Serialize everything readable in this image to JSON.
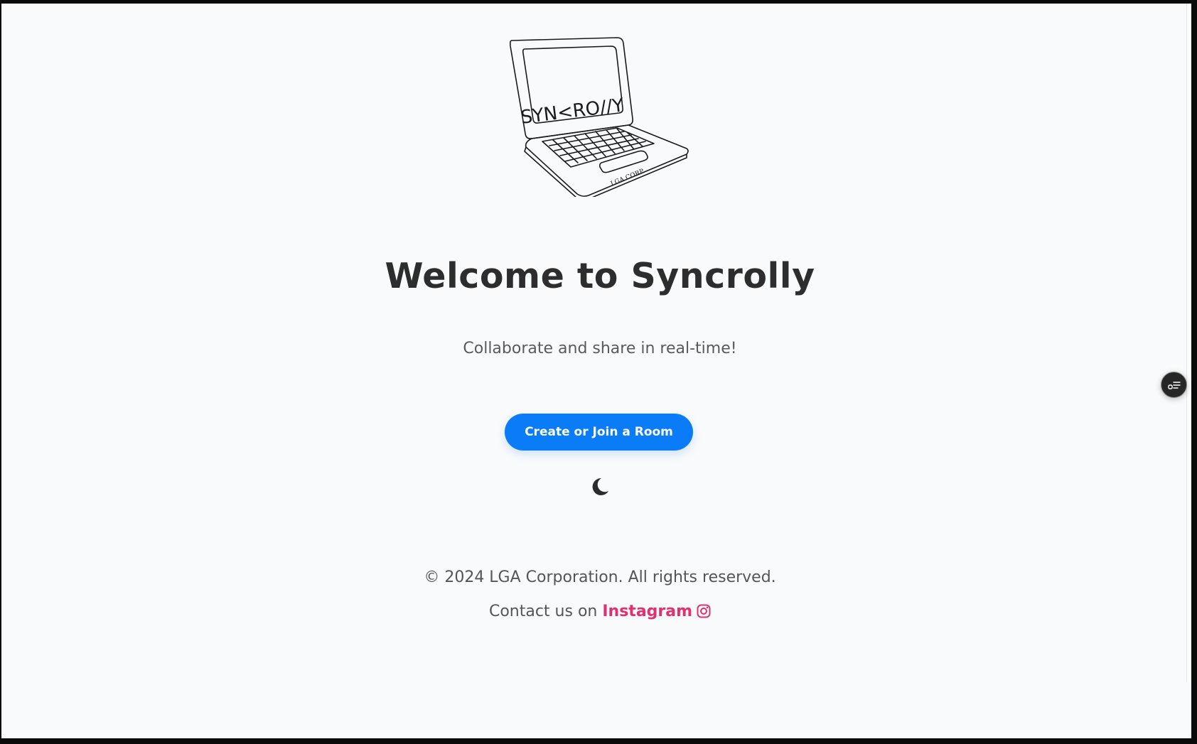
{
  "hero": {
    "title": "Welcome to Syncrolly",
    "subtitle": "Collaborate and share in real-time!",
    "cta_label": "Create or Join a Room"
  },
  "logo": {
    "screen_text": "SYN<RO//Y",
    "base_text": "LGA CORP."
  },
  "theme_toggle": {
    "icon": "moon-icon"
  },
  "side_widget": {
    "icon": "list-toggle-icon"
  },
  "footer": {
    "copyright": "© 2024 LGA Corporation. All rights reserved.",
    "contact_prefix": "Contact us on",
    "instagram_label": "Instagram",
    "instagram_icon": "instagram-icon"
  },
  "colors": {
    "accent": "#0a7cf7",
    "instagram": "#e1306c",
    "title": "#2d2d2d",
    "background": "#f9fafb"
  }
}
